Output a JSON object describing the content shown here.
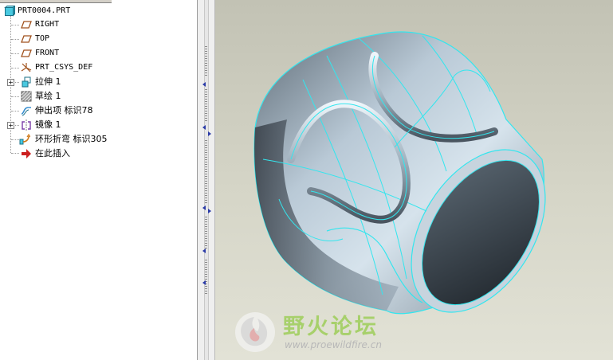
{
  "model_tree": {
    "root": {
      "label": "PRT0004.PRT",
      "icon": "part-icon"
    },
    "items": [
      {
        "label": "RIGHT",
        "icon": "datum-plane-icon",
        "expandable": false
      },
      {
        "label": "TOP",
        "icon": "datum-plane-icon",
        "expandable": false
      },
      {
        "label": "FRONT",
        "icon": "datum-plane-icon",
        "expandable": false
      },
      {
        "label": "PRT_CSYS_DEF",
        "icon": "coordinate-system-icon",
        "expandable": false
      },
      {
        "label": "拉伸 1",
        "icon": "extrude-icon",
        "expandable": true
      },
      {
        "label": "草绘 1",
        "icon": "sketch-icon",
        "expandable": false
      },
      {
        "label": "伸出项 标识78",
        "icon": "protrusion-icon",
        "expandable": false
      },
      {
        "label": "镜像 1",
        "icon": "mirror-icon",
        "expandable": true
      },
      {
        "label": "环形折弯 标识305",
        "icon": "toroidal-bend-icon",
        "expandable": false
      },
      {
        "label": "在此插入",
        "icon": "insert-here-arrow-icon",
        "expandable": false
      }
    ]
  },
  "watermark": {
    "title": "野火论坛",
    "url": "www.proewildfire.cn",
    "title_color": "#a7d06b"
  },
  "colors": {
    "edge_highlight": "#33e6ee",
    "viewport_background": "#d2d2c4"
  }
}
